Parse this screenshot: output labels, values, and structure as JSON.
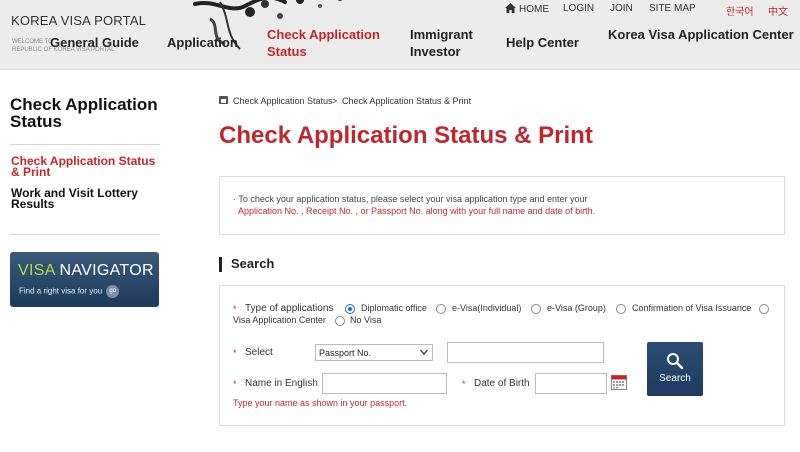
{
  "header": {
    "logo_title": "KOREA VISA PORTAL",
    "logo_sub1": "WELCOME TO",
    "logo_sub2": "REPUBLIC OF KOREA VISA PORTAL",
    "util_links": [
      "HOME",
      "LOGIN",
      "JOIN",
      "SITE MAP",
      "한국어",
      "中文"
    ],
    "nav": [
      {
        "label": "General Guide"
      },
      {
        "label": "Application"
      },
      {
        "label_line1": "Check Application",
        "label_line2": "Status",
        "active": true
      },
      {
        "label_line1": "Immigrant",
        "label_line2": "Investor"
      },
      {
        "label": "Help Center"
      },
      {
        "label": "Korea Visa Application Center"
      }
    ]
  },
  "sidebar": {
    "title_line1": "Check Application",
    "title_line2": "Status",
    "items": [
      {
        "line1": "Check Application Status",
        "line2": "& Print",
        "active": true
      },
      {
        "line1": "Work and Visit Lottery",
        "line2": "Results"
      }
    ],
    "banner": {
      "title_a": "VISA",
      "title_b": "NAVIGATOR",
      "subtitle": "Find a right visa for you",
      "badge": "go"
    }
  },
  "breadcrumb": [
    "Check Application Status",
    "Check Application Status & Print"
  ],
  "breadcrumb_sep": ">",
  "page_title": "Check Application Status & Print",
  "info": {
    "line1": "· To check your application status, please select your visa application type and enter your",
    "line2": "Application No. , Receipt No. , or Passport No. along with your full name and date of birth."
  },
  "section_title": "Search",
  "form": {
    "required_mark": "*",
    "type_label": "Type of applications",
    "type_options": [
      {
        "label": "Diplomatic office",
        "checked": true
      },
      {
        "label": "e-Visa(Individual)",
        "checked": false
      },
      {
        "label": "e-Visa (Group)",
        "checked": false
      },
      {
        "label": "Confirmation of Visa Issuance",
        "checked": false
      },
      {
        "label": "Visa Application Center",
        "checked": false
      },
      {
        "label": "No Visa",
        "checked": false
      }
    ],
    "select_label": "Select",
    "select_value": "Passport No.",
    "select_input_value": "",
    "name_label": "Name in English",
    "name_value": "",
    "dob_label": "Date of Birth",
    "dob_value": "",
    "hint": "Type your name as shown in your passport.",
    "search_button": "Search"
  },
  "colors": {
    "accent_red": "#c0272d",
    "nav_blue": "#1d3a5f",
    "header_gray": "#ececec"
  }
}
